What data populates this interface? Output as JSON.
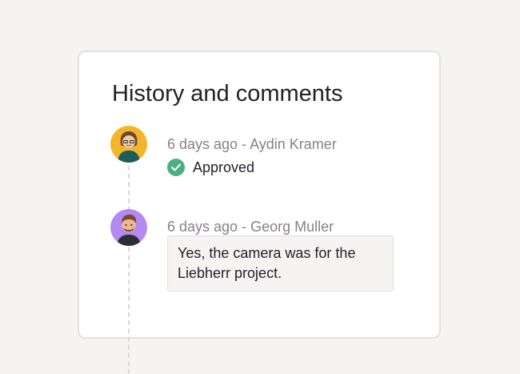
{
  "panel": {
    "title": "History and comments"
  },
  "entries": [
    {
      "author": "Aydin Kramer",
      "time": "6 days ago",
      "meta": "6 days ago - Aydin Kramer",
      "type": "status",
      "status": "Approved",
      "status_icon": "check-icon",
      "status_color": "#4caf83",
      "avatar_color": "#f4b52b"
    },
    {
      "author": "Georg Muller",
      "time": "6 days ago",
      "meta": "6 days ago - Georg Muller",
      "type": "comment",
      "comment": "Yes, the camera was for the Liebherr project.",
      "avatar_color": "#b38af2"
    }
  ],
  "colors": {
    "background": "#f5f4f2",
    "card": "#ffffff",
    "text": "#24202a",
    "muted": "#86818a",
    "approved": "#4caf83"
  }
}
